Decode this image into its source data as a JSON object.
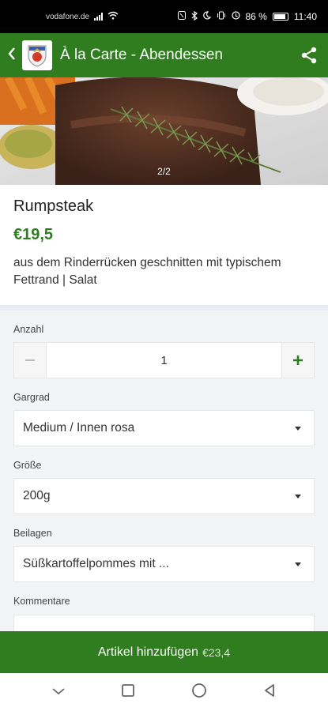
{
  "status_bar": {
    "carrier": "vodafone.de",
    "battery_percent": "86 %",
    "time": "11:40"
  },
  "app_bar": {
    "title": "À la Carte - Abendessen",
    "back_icon": "chevron-left-icon",
    "share_icon": "share-icon"
  },
  "gallery": {
    "counter": "2/2"
  },
  "product": {
    "name": "Rumpsteak",
    "price": "€19,5",
    "description": "aus dem Rinderrücken geschnitten mit typischem Fettrand | Salat"
  },
  "form": {
    "quantity_label": "Anzahl",
    "quantity_value": "1",
    "doneness_label": "Gargrad",
    "doneness_value": "Medium / Innen rosa",
    "size_label": "Größe",
    "size_value": "200g",
    "sides_label": "Beilagen",
    "sides_value": "Süßkartoffelpommes mit  ...",
    "comments_label": "Kommentare"
  },
  "add_button": {
    "label": "Artikel hinzufügen",
    "total": "€23,4"
  },
  "colors": {
    "brand": "#2f7d1f"
  }
}
